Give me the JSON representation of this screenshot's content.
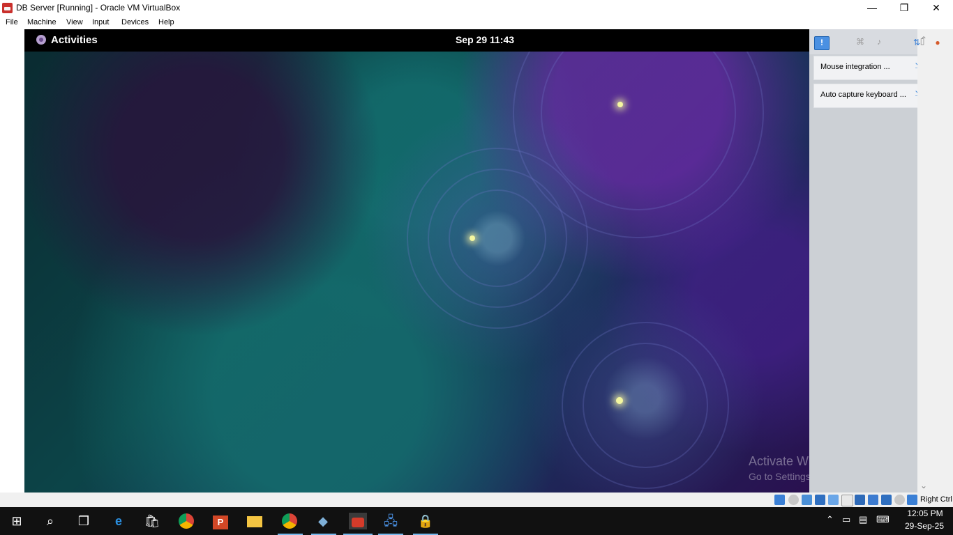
{
  "window": {
    "title": "DB Server [Running] - Oracle VM VirtualBox",
    "minimize": "—",
    "maximize": "❐",
    "close": "✕"
  },
  "menu": [
    "File",
    "Machine",
    "View",
    "Input",
    "Devices",
    "Help"
  ],
  "guest": {
    "activities_label": "Activities",
    "clock": "Sep 29  11:43"
  },
  "notifications": [
    {
      "label": "Mouse integration ..."
    },
    {
      "label": "Auto capture keyboard ..."
    }
  ],
  "watermark": {
    "line1": "Activate Windows",
    "line2": "Go to Settings to activate Windows."
  },
  "status_bar": {
    "host_key": "Right Ctrl"
  },
  "taskbar": {
    "time": "12:05 PM",
    "date": "29-Sep-25"
  }
}
